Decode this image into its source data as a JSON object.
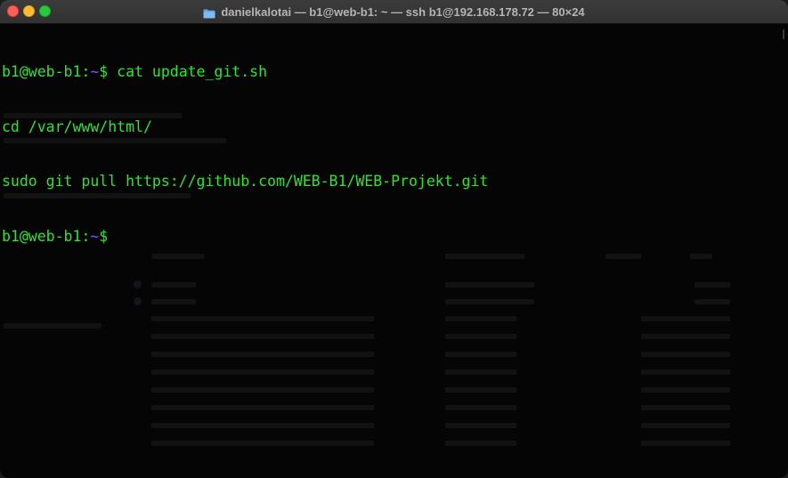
{
  "window": {
    "title": "danielkalotai — b1@web-b1: ~ — ssh b1@192.168.178.72 — 80×24",
    "title_icon": "folder-icon",
    "colors": {
      "close": "#fe5f57",
      "minimize": "#febc2e",
      "maximize": "#28c840",
      "text": "#2ce62c",
      "tilde": "#6c5cff",
      "background": "#050505"
    }
  },
  "terminal": {
    "lines": [
      {
        "user": "b1@web-b1:",
        "tilde": "~",
        "symbol": "$ ",
        "command": "cat update_git.sh"
      },
      {
        "text": "cd /var/www/html/"
      },
      {
        "text": "sudo git pull https://github.com/WEB-B1/WEB-Projekt.git"
      },
      {
        "user": "b1@web-b1:",
        "tilde": "~",
        "symbol": "$ ",
        "command": ""
      }
    ]
  }
}
